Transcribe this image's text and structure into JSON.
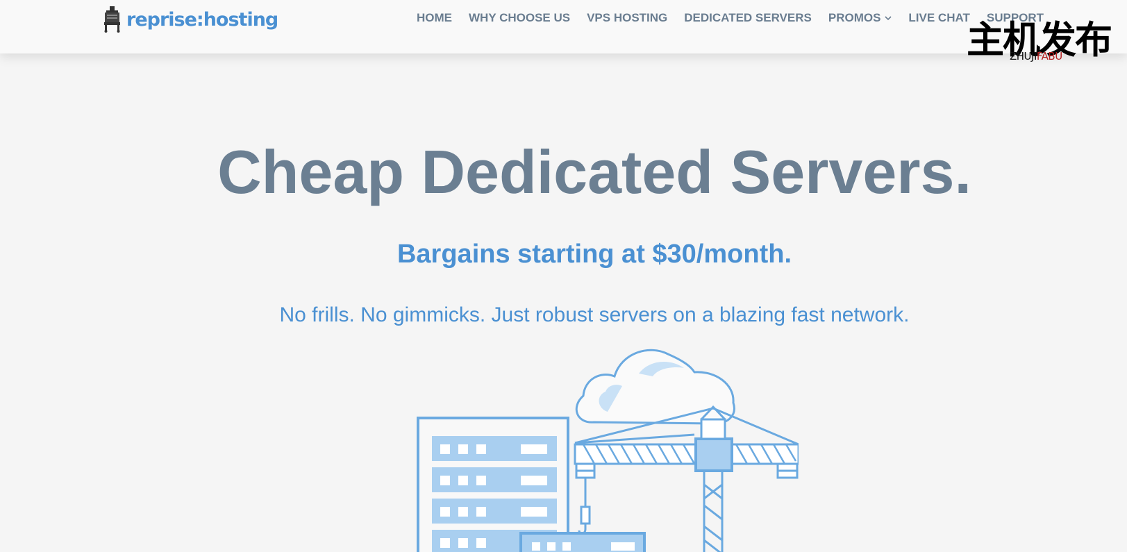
{
  "header": {
    "logo_text": "reprise:hosting",
    "nav": [
      {
        "label": "HOME"
      },
      {
        "label": "WHY CHOOSE US"
      },
      {
        "label": "VPS HOSTING"
      },
      {
        "label": "DEDICATED SERVERS"
      },
      {
        "label": "PROMOS",
        "has_dropdown": true
      },
      {
        "label": "LIVE CHAT"
      },
      {
        "label": "SUPPORT"
      }
    ]
  },
  "watermark": {
    "chinese": "主机发布",
    "latin_part1": "ZHUJI",
    "latin_part2": "FABU"
  },
  "hero": {
    "title": "Cheap Dedicated Servers.",
    "subtitle": "Bargains starting at $30/month.",
    "tagline": "No frills. No gimmicks. Just robust servers on a blazing fast network."
  },
  "colors": {
    "background": "#f5f5f5",
    "header_bg": "#f9f9f9",
    "brand_blue": "#4a90d2",
    "nav_gray": "#6a7d90",
    "title_gray": "#6b7f92",
    "illustration_stroke": "#6aa9e0",
    "illustration_fill": "#a9cff0"
  },
  "icons": {
    "logo": "fountain-pen-logo-icon",
    "dropdown": "chevron-down-icon",
    "illustration": "server-crane-cloud-illustration"
  }
}
